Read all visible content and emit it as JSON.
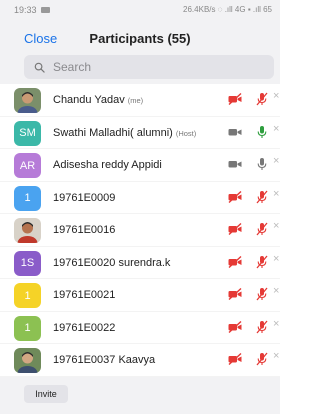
{
  "status_bar": {
    "time": "19:33",
    "right": "26.4KB/s ◌ .ıll 4G ▪ .ıll 65"
  },
  "header": {
    "close_label": "Close",
    "title": "Participants (55)"
  },
  "search": {
    "placeholder": "Search"
  },
  "colors": {
    "accent": "#1a73e8",
    "muted_red": "#e53935",
    "unmuted_green": "#2e9e3e",
    "icon_gray": "#777777"
  },
  "participants": [
    {
      "name": "Chandu Yadav",
      "tag": "(me)",
      "avatar_type": "photo",
      "avatar_icon": "person-photo",
      "video": "off",
      "mic": "muted"
    },
    {
      "name": "Swathi Malladhi( alumni)",
      "tag": "(Host)",
      "avatar_type": "initials",
      "initials": "SM",
      "avatar_color": "#3bb8a8",
      "video": "on",
      "mic": "unmuted"
    },
    {
      "name": "Adisesha reddy Appidi",
      "tag": "",
      "avatar_type": "initials",
      "initials": "AR",
      "avatar_color": "#b67bd8",
      "video": "on",
      "mic": "on"
    },
    {
      "name": "19761E0009",
      "tag": "",
      "avatar_type": "initials",
      "initials": "1",
      "avatar_color": "#4aa3f0",
      "video": "off",
      "mic": "muted"
    },
    {
      "name": "19761E0016",
      "tag": "",
      "avatar_type": "photo",
      "avatar_icon": "person-photo",
      "video": "off",
      "mic": "muted"
    },
    {
      "name": "19761E0020 surendra.k",
      "tag": "",
      "avatar_type": "initials",
      "initials": "1S",
      "avatar_color": "#8a5cc9",
      "video": "off",
      "mic": "muted"
    },
    {
      "name": "19761E0021",
      "tag": "",
      "avatar_type": "initials",
      "initials": "1",
      "avatar_color": "#f5d327",
      "video": "off",
      "mic": "muted"
    },
    {
      "name": "19761E0022",
      "tag": "",
      "avatar_type": "initials",
      "initials": "1",
      "avatar_color": "#8cc152",
      "video": "off",
      "mic": "muted"
    },
    {
      "name": "19761E0037 Kaavya",
      "tag": "",
      "avatar_type": "photo",
      "avatar_icon": "person-photo",
      "video": "off",
      "mic": "muted"
    }
  ],
  "footer": {
    "invite_label": "Invite"
  }
}
